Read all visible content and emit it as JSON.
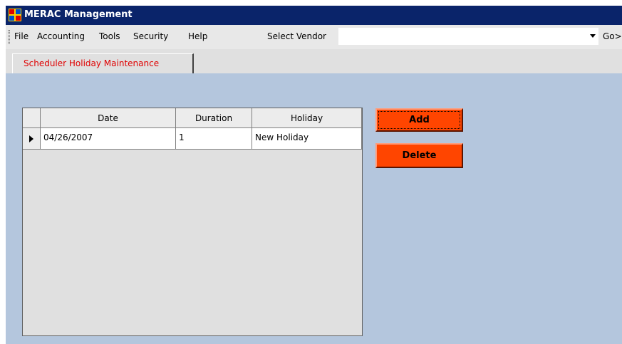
{
  "window": {
    "title": "MERAC Management",
    "title_bar_color": "#0a246a"
  },
  "menu": {
    "items": [
      "File",
      "Accounting",
      "Tools",
      "Security",
      "Help"
    ],
    "vendor_label": "Select Vendor",
    "vendor_value": "",
    "go_label": "Go>"
  },
  "tabs": [
    {
      "label": "Scheduler Holiday Maintenance",
      "active": true,
      "color": "#e00000"
    }
  ],
  "grid": {
    "columns": [
      "Date",
      "Duration",
      "Holiday"
    ],
    "rows": [
      {
        "date": "04/26/2007",
        "duration": "1",
        "holiday": "New Holiday",
        "current": true
      }
    ]
  },
  "actions": {
    "add_label": "Add",
    "delete_label": "Delete",
    "button_color": "#ff4500"
  },
  "colors": {
    "content_background": "#b4c6dd"
  }
}
